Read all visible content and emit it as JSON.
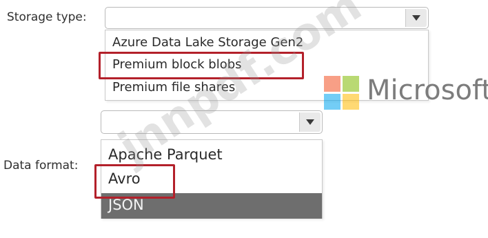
{
  "storage": {
    "label": "Storage type:",
    "selected": "",
    "options": [
      "Azure Data Lake Storage Gen2",
      "Premium block blobs",
      "Premium file shares"
    ]
  },
  "format": {
    "label": "Data format:",
    "selected": "",
    "options": [
      "Apache Parquet",
      "Avro",
      "JSON"
    ]
  },
  "brand": {
    "name": "Microsoft",
    "colors": [
      "#f25022",
      "#7fba00",
      "#00a4ef",
      "#ffb900"
    ]
  },
  "watermark": "jnnpdf.com",
  "colors": {
    "highlight": "#b3202a",
    "dark_row": "#6e6e6e"
  }
}
